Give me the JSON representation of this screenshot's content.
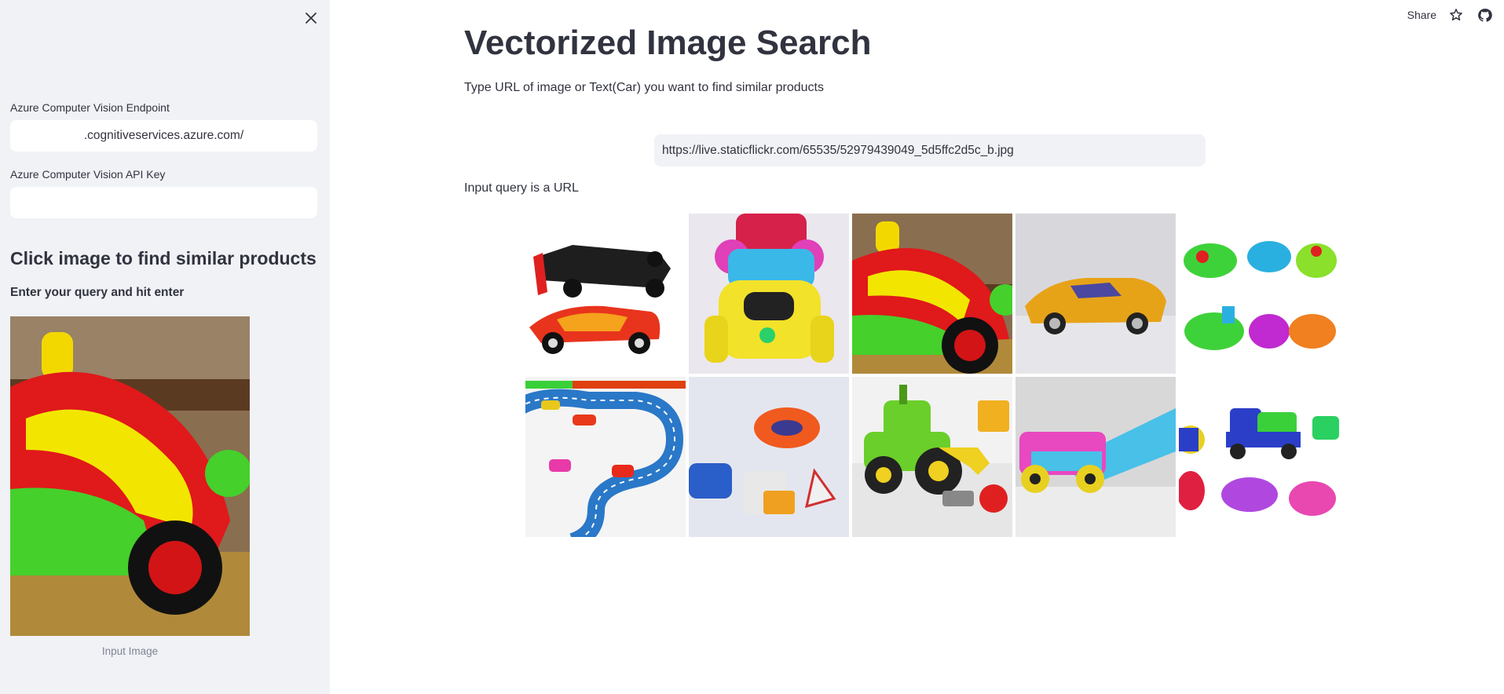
{
  "sidebar": {
    "close_icon": "close-icon",
    "endpoint": {
      "label": "Azure Computer Vision Endpoint",
      "value": ".cognitiveservices.azure.com/"
    },
    "api_key": {
      "label": "Azure Computer Vision API Key",
      "value": ""
    },
    "heading": "Click image to find similar products",
    "subheading": "Enter your query and hit enter",
    "input_image_caption": "Input Image"
  },
  "toolbar": {
    "share_label": "Share",
    "star_icon": "star-icon",
    "github_icon": "github-icon"
  },
  "main": {
    "title": "Vectorized Image Search",
    "subtitle": "Type URL of image or Text(Car) you want to find similar products",
    "query_value": "https://live.staticflickr.com/65535/52979439049_5d5ffc2d5c_b.jpg",
    "query_status": "Input query is a URL",
    "results": [
      "Red and black toy race cars",
      "Colorful stacked toy cars",
      "Red, yellow and green toy car",
      "Yellow toy sports car",
      "Green and blue toy bumper cars",
      "Toy cars on a blue race track",
      "Orange and blue toy cars",
      "Green toy tractor with tools",
      "Pink toy car on a blue track",
      "Colorful toy trucks and cars"
    ]
  },
  "colors": {
    "sidebar_bg": "#f0f2f6",
    "text": "#31333f",
    "input_bg": "#f0f2f6",
    "caption": "#808495"
  }
}
